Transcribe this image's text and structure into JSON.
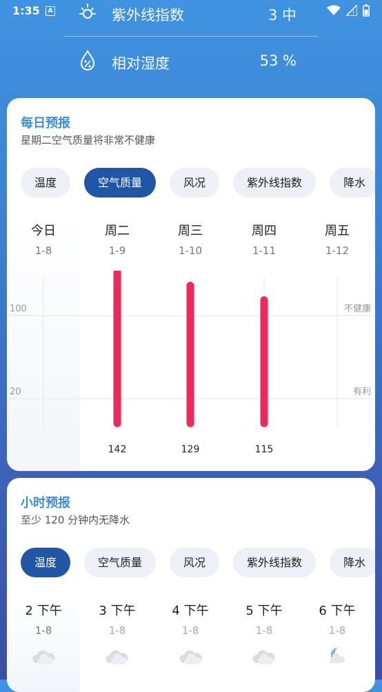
{
  "status_bar": {
    "time": "1:35",
    "notification_letter": "A"
  },
  "details": [
    {
      "icon": "sun-icon",
      "label": "紫外线指数",
      "value": "3 中"
    },
    {
      "icon": "humidity-drop-icon",
      "label": "相对湿度",
      "value": "53 %"
    }
  ],
  "daily": {
    "title": "每日预报",
    "subtitle": "星期二空气质量将非常不健康",
    "tabs": [
      "温度",
      "空气质量",
      "风况",
      "紫外线指数",
      "降水"
    ],
    "active_tab": 1,
    "columns": [
      {
        "day": "今日",
        "date": "1-8"
      },
      {
        "day": "周二",
        "date": "1-9"
      },
      {
        "day": "周三",
        "date": "1-10"
      },
      {
        "day": "周四",
        "date": "1-11"
      },
      {
        "day": "周五",
        "date": "1-12"
      }
    ],
    "chart_data": {
      "type": "bar",
      "categories": [
        "1-9",
        "1-10",
        "1-11"
      ],
      "values": [
        142,
        129,
        115
      ],
      "value_labels": [
        "142",
        "129",
        "115"
      ],
      "reference_lines": [
        {
          "value": 100,
          "left_label": "100",
          "right_label": "不健康"
        },
        {
          "value": 20,
          "left_label": "20",
          "right_label": "有利"
        }
      ],
      "bar_color": "#f0295a"
    }
  },
  "hourly": {
    "title": "小时预报",
    "subtitle": "至少 120 分钟内无降水",
    "tabs": [
      "温度",
      "空气质量",
      "风况",
      "紫外线指数",
      "降水"
    ],
    "active_tab": 0,
    "columns": [
      {
        "time": "2 下午",
        "date": "1-8",
        "icon": "cloudy-icon"
      },
      {
        "time": "3 下午",
        "date": "1-8",
        "icon": "cloudy-icon"
      },
      {
        "time": "4 下午",
        "date": "1-8",
        "icon": "cloudy-icon"
      },
      {
        "time": "5 下午",
        "date": "1-8",
        "icon": "cloudy-icon"
      },
      {
        "time": "6 下午",
        "date": "1-8",
        "icon": "moon-cloud-icon"
      }
    ]
  }
}
